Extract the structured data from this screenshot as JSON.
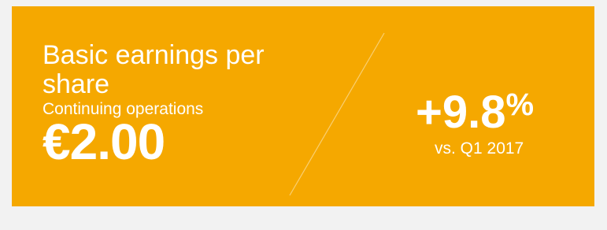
{
  "panel": {
    "background_color": "#f5a800",
    "text_color": "#ffffff"
  },
  "metric": {
    "title": "Basic earnings per share",
    "subtitle": "Continuing operations",
    "value": "€2.00"
  },
  "change": {
    "value": "+9.8",
    "unit": "%",
    "comparison": "vs. Q1 2017"
  }
}
